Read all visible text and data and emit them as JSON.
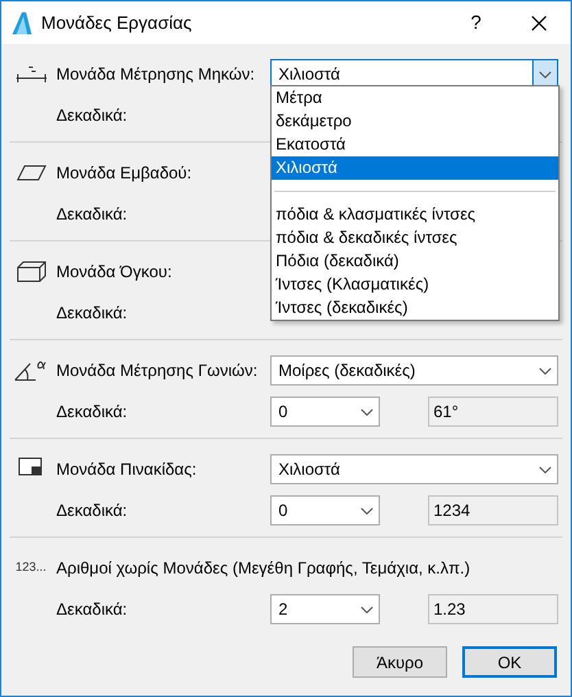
{
  "window": {
    "title": "Μονάδες Εργασίας",
    "help": "?"
  },
  "sections": [
    {
      "kind": "length",
      "label": "Μονάδα Μέτρησης Μηκών:",
      "unit": "Χιλιοστά",
      "decimals_label": "Δεκαδικά:",
      "open": true,
      "options": [
        {
          "kind": "item",
          "label": "Μέτρα",
          "selected": false
        },
        {
          "kind": "item",
          "label": "δεκάμετρο",
          "selected": false
        },
        {
          "kind": "item",
          "label": "Εκατοστά",
          "selected": false
        },
        {
          "kind": "item",
          "label": "Χιλιοστά",
          "selected": true
        },
        {
          "kind": "separator"
        },
        {
          "kind": "item",
          "label": "πόδια & κλασματικές ίντσες",
          "selected": false
        },
        {
          "kind": "item",
          "label": "πόδια & δεκαδικές ίντσες",
          "selected": false
        },
        {
          "kind": "item",
          "label": "Πόδια (δεκαδικά)",
          "selected": false
        },
        {
          "kind": "item",
          "label": "Ίντσες (Κλασματικές)",
          "selected": false
        },
        {
          "kind": "item",
          "label": "Ίντσες (δεκαδικές)",
          "selected": false
        }
      ]
    },
    {
      "kind": "area",
      "label": "Μονάδα Εμβαδού:",
      "decimals_label": "Δεκαδικά:"
    },
    {
      "kind": "volume",
      "label": "Μονάδα Όγκου:",
      "decimals_label": "Δεκαδικά:"
    },
    {
      "kind": "angle",
      "label": "Μονάδα Μέτρησης Γωνιών:",
      "unit": "Μοίρες (δεκαδικές)",
      "decimals_label": "Δεκαδικά:",
      "decimals": "0",
      "preview": "61°"
    },
    {
      "kind": "layout",
      "label": "Μονάδα Πινακίδας:",
      "unit": "Χιλιοστά",
      "decimals_label": "Δεκαδικά:",
      "decimals": "0",
      "preview": "1234"
    },
    {
      "kind": "number",
      "icon_text": "123...",
      "label": "Αριθμοί χωρίς Μονάδες (Μεγέθη Γραφής, Τεμάχια, κ.λπ.)",
      "decimals_label": "Δεκαδικά:",
      "decimals": "2",
      "preview": "1.23"
    }
  ],
  "buttons": [
    {
      "label": "Άκυρο",
      "default": false
    },
    {
      "label": "OK",
      "default": true
    }
  ]
}
